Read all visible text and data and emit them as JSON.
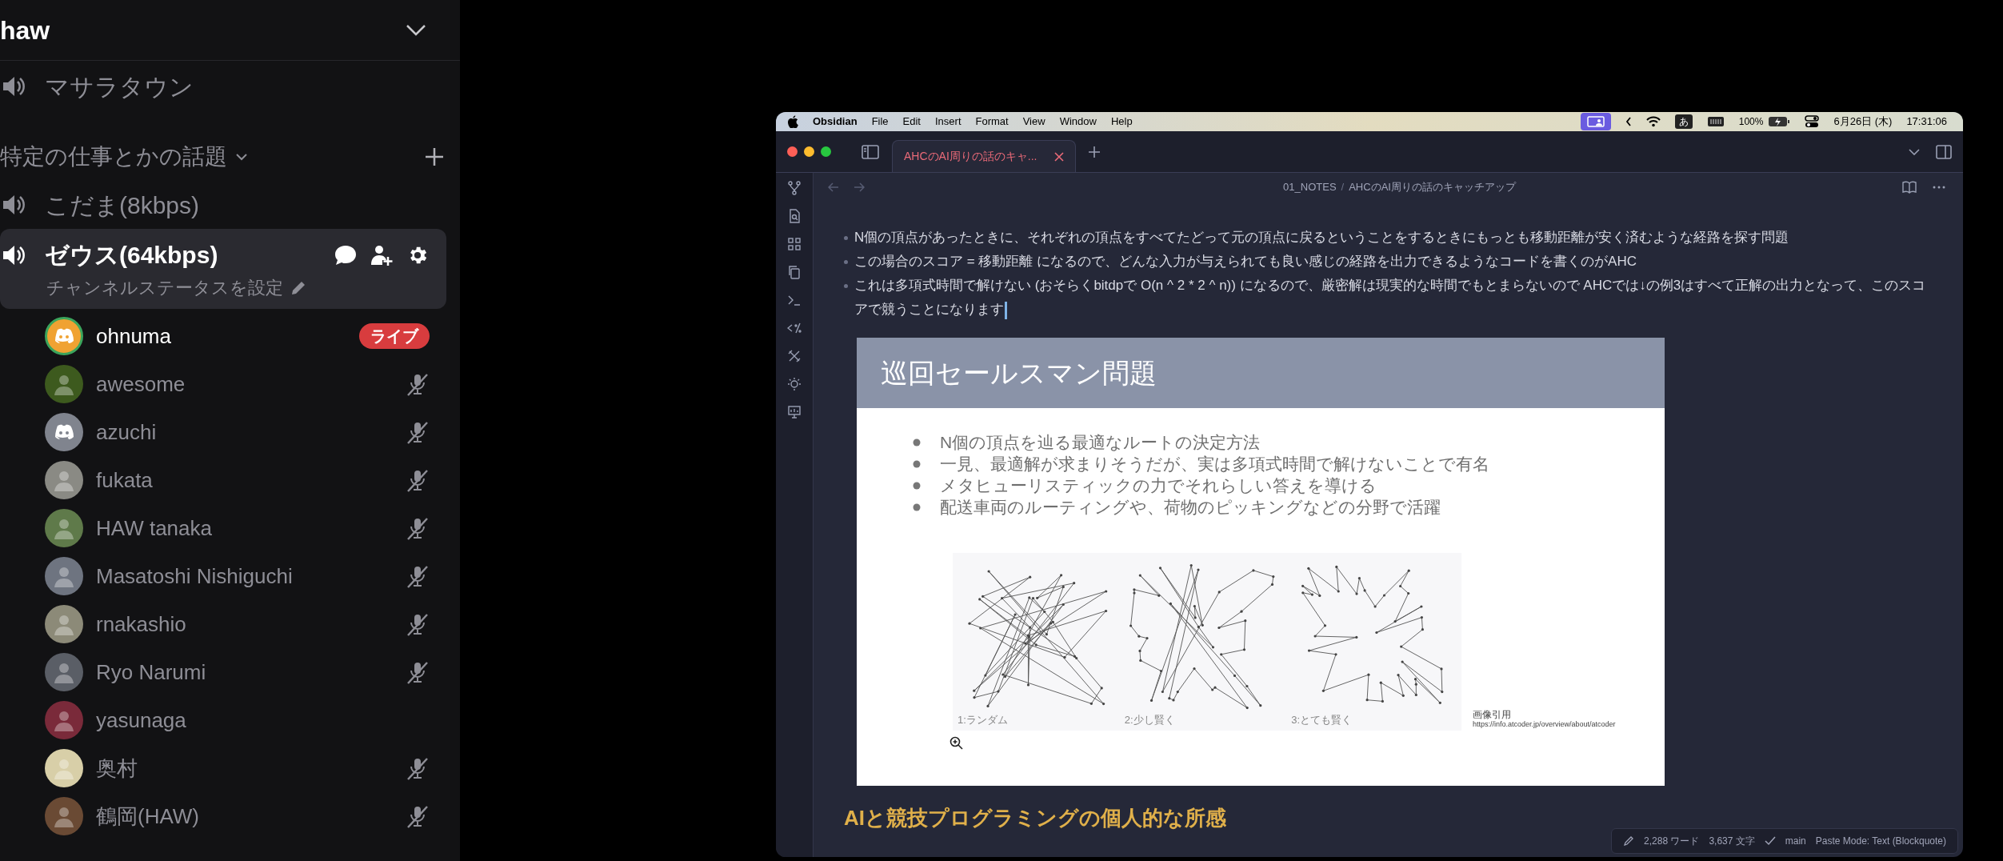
{
  "server": {
    "name": "haw"
  },
  "channels_top": [
    {
      "name": "マサラタウン"
    }
  ],
  "category": {
    "name": "特定の仕事とかの話題"
  },
  "channels": [
    {
      "name": "こだま(8kbps)",
      "selected": false
    },
    {
      "name": "ゼウス(64kbps)",
      "selected": true,
      "status": "チャンネルステータスを設定"
    }
  ],
  "members": [
    {
      "name": "ohnuma",
      "speaking": true,
      "muted": false,
      "badge": "ライブ",
      "kind": "logo",
      "color": "#f0a232"
    },
    {
      "name": "awesome",
      "speaking": false,
      "muted": true,
      "kind": "photo",
      "color": "#3d5a1e"
    },
    {
      "name": "azuchi",
      "speaking": false,
      "muted": true,
      "kind": "logo",
      "color": "#80848e"
    },
    {
      "name": "fukata",
      "speaking": false,
      "muted": true,
      "kind": "photo",
      "color": "#8a8a84"
    },
    {
      "name": "HAW tanaka",
      "speaking": false,
      "muted": true,
      "kind": "photo",
      "color": "#5f7a4a"
    },
    {
      "name": "Masatoshi Nishiguchi",
      "speaking": false,
      "muted": true,
      "kind": "photo",
      "color": "#6e7480"
    },
    {
      "name": "rnakashio",
      "speaking": false,
      "muted": true,
      "kind": "photo",
      "color": "#8c8a78"
    },
    {
      "name": "Ryo Narumi",
      "speaking": false,
      "muted": true,
      "kind": "photo",
      "color": "#5a5e66"
    },
    {
      "name": "yasunaga",
      "speaking": false,
      "muted": false,
      "kind": "photo",
      "color": "#7a2a3a"
    },
    {
      "name": "奥村",
      "speaking": false,
      "muted": true,
      "kind": "photo",
      "color": "#d8cfa8"
    },
    {
      "name": "鶴岡(HAW)",
      "speaking": false,
      "muted": true,
      "kind": "photo",
      "color": "#6a4a34"
    }
  ],
  "shared_screen": {
    "menu_bar": {
      "app": "Obsidian",
      "items": [
        "File",
        "Edit",
        "Insert",
        "Format",
        "View",
        "Window",
        "Help"
      ],
      "status": [
        "100%",
        "6月26日 (木)",
        "17:31:06"
      ],
      "keyboard": "あ"
    },
    "tab": {
      "title": "AHCのAI周りの話のキャ...",
      "selected": true
    },
    "breadcrumb": [
      "01_NOTES",
      "/",
      "AHCのAI周りの話のキャッチアップ"
    ],
    "bullets": [
      "N個の頂点があったときに、それぞれの頂点をすべてたどって元の頂点に戻るということをするときにもっとも移動距離が安く済むような経路を探す問題",
      "この場合のスコア = 移動距離 になるので、どんな入力が与えられても良い感じの経路を出力できるようなコードを書くのがAHC",
      "これは多項式時間で解けない (おそらくbitdpで O(n ^ 2 * 2 ^ n)) になるので、厳密解は現実的な時間でもとまらないので AHCでは↓の例3はすべて正解の出力となって、このスコアで競うことになります"
    ],
    "slide": {
      "title": "巡回セールスマン問題",
      "bullets": [
        "N個の頂点を辿る最適なルートの決定方法",
        "一見、最適解が求まりそうだが、実は多項式時間で解けないことで有名",
        "メタヒューリスティックの力でそれらしい答えを導ける",
        "配送車両のルーティングや、荷物のピッキングなどの分野で活躍"
      ],
      "panels": [
        "1:ランダム",
        "2:少し賢く",
        "3:とても賢く"
      ],
      "credit": [
        "画像引用",
        "https://info.atcoder.jp/overview/about/atcoder"
      ]
    },
    "heading": "AIと競技プログラミングの個人的な所感",
    "status_bar": {
      "words": "2,288 ワード",
      "chars": "3,637 文字",
      "branch": "main",
      "paste_mode": "Paste Mode: Text (Blockquote)"
    }
  }
}
